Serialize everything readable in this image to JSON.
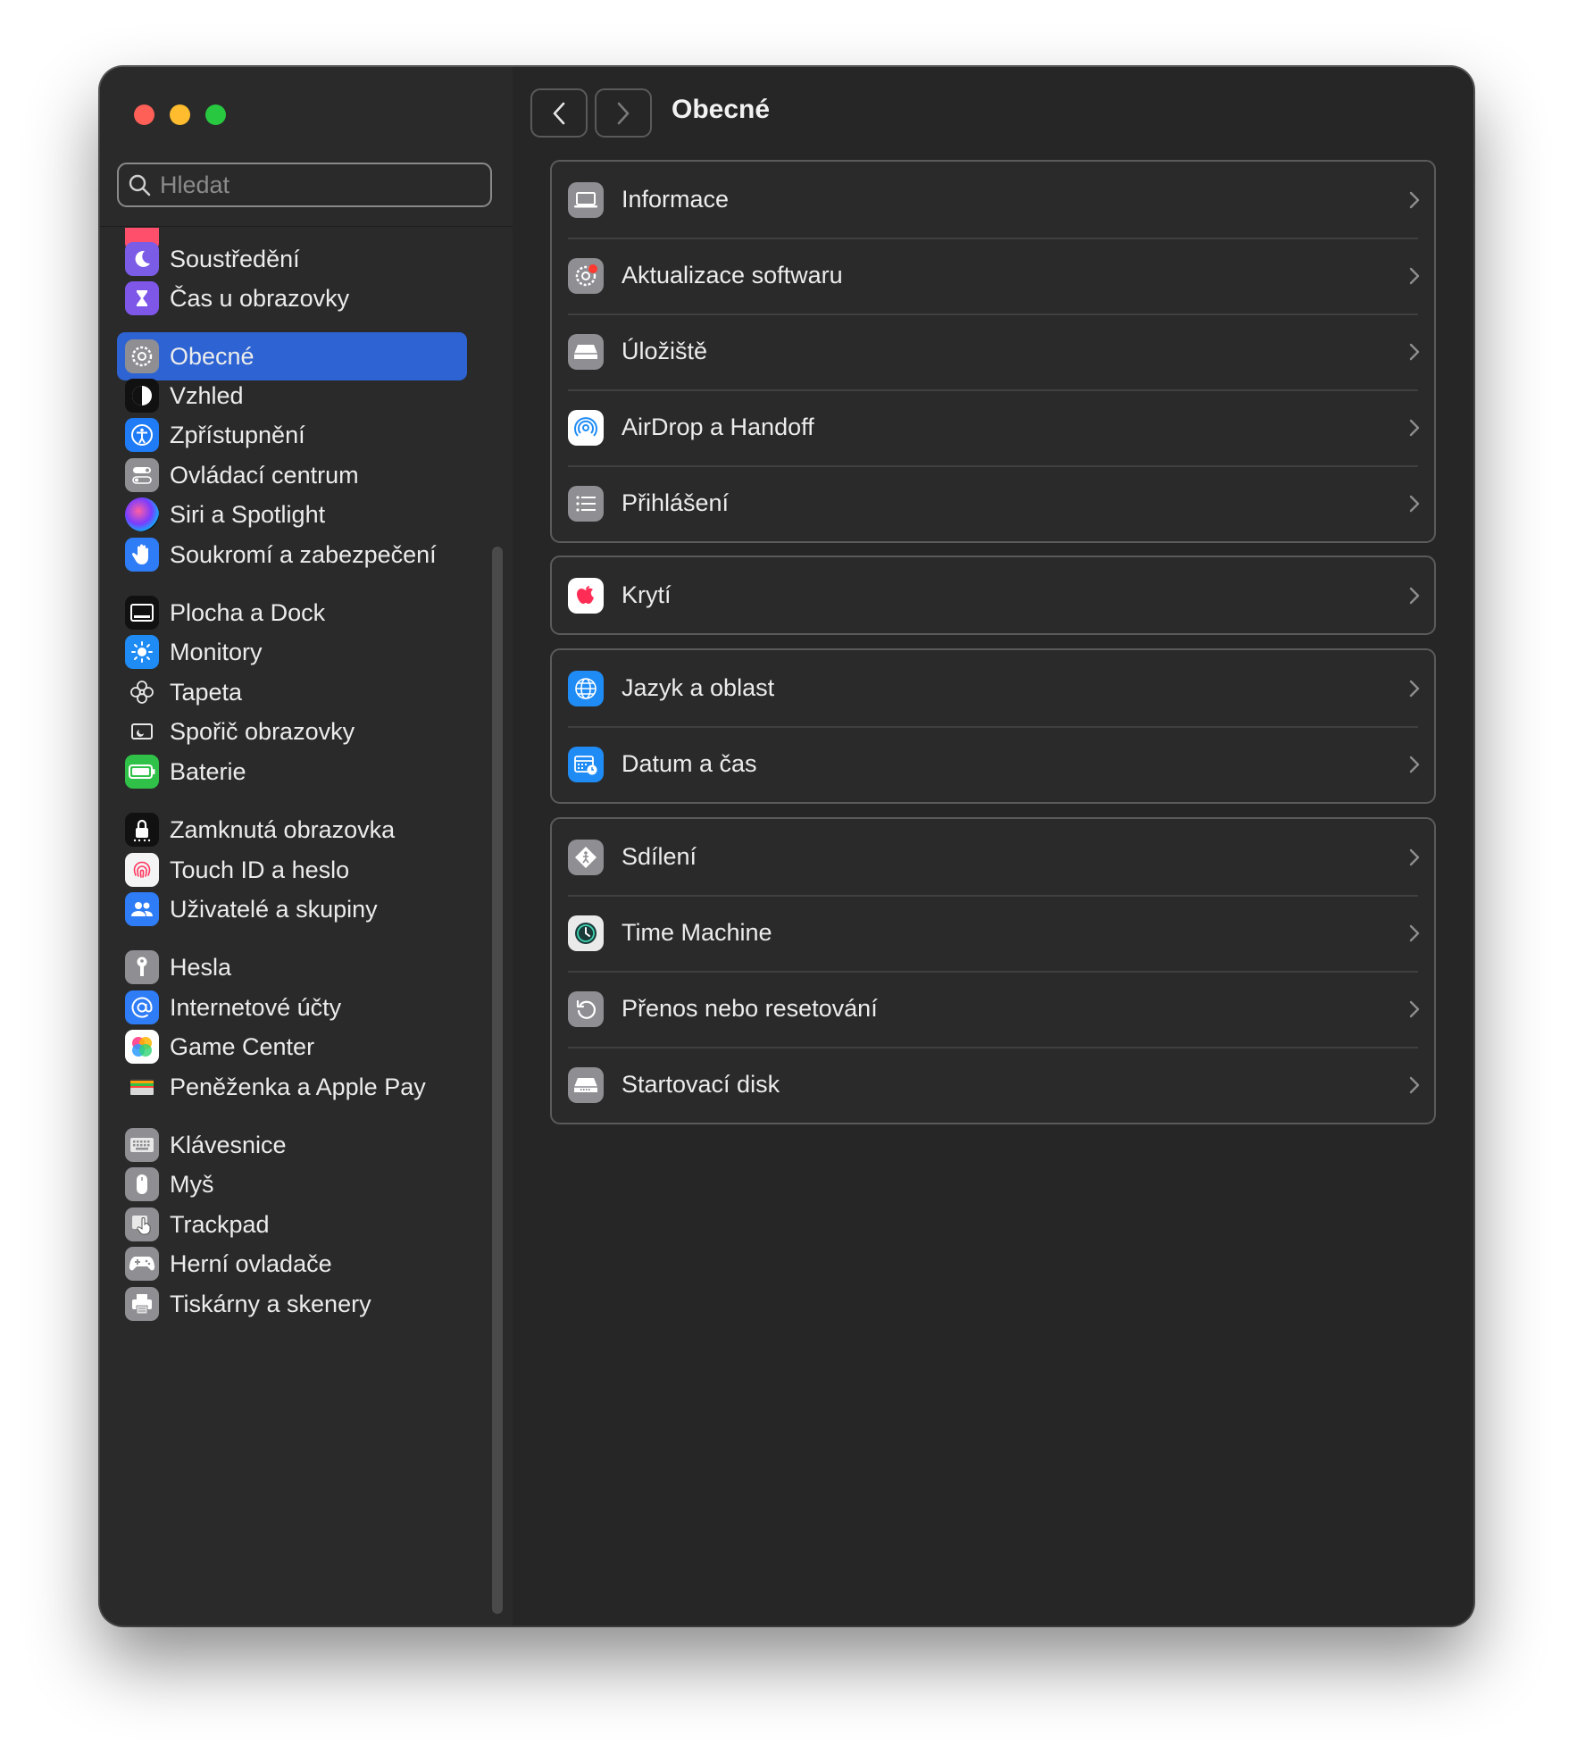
{
  "search": {
    "placeholder": "Hledat"
  },
  "sidebar": {
    "items": [
      {
        "label": "Soustředění",
        "icon": "moon-icon"
      },
      {
        "label": "Čas u obrazovky",
        "icon": "hourglass-icon"
      },
      {
        "label": "Obecné",
        "icon": "gear-icon",
        "active": true
      },
      {
        "label": "Vzhled",
        "icon": "appearance-icon"
      },
      {
        "label": "Zpřístupnění",
        "icon": "accessibility-icon"
      },
      {
        "label": "Ovládací centrum",
        "icon": "control-center-icon"
      },
      {
        "label": "Siri a Spotlight",
        "icon": "siri-icon"
      },
      {
        "label": "Soukromí a zabezpečení",
        "icon": "hand-icon"
      },
      {
        "label": "Plocha a Dock",
        "icon": "dock-icon"
      },
      {
        "label": "Monitory",
        "icon": "sun-icon"
      },
      {
        "label": "Tapeta",
        "icon": "flower-icon"
      },
      {
        "label": "Spořič obrazovky",
        "icon": "screensaver-icon"
      },
      {
        "label": "Baterie",
        "icon": "battery-icon"
      },
      {
        "label": "Zamknutá obrazovka",
        "icon": "lock-icon"
      },
      {
        "label": "Touch ID a heslo",
        "icon": "fingerprint-icon"
      },
      {
        "label": "Uživatelé a skupiny",
        "icon": "users-icon"
      },
      {
        "label": "Hesla",
        "icon": "key-icon"
      },
      {
        "label": "Internetové účty",
        "icon": "at-icon"
      },
      {
        "label": "Game Center",
        "icon": "game-center-icon"
      },
      {
        "label": "Peněženka a Apple Pay",
        "icon": "wallet-icon"
      },
      {
        "label": "Klávesnice",
        "icon": "keyboard-icon"
      },
      {
        "label": "Myš",
        "icon": "mouse-icon"
      },
      {
        "label": "Trackpad",
        "icon": "trackpad-icon"
      },
      {
        "label": "Herní ovladače",
        "icon": "gamepad-icon"
      },
      {
        "label": "Tiskárny a skenery",
        "icon": "printer-icon"
      }
    ]
  },
  "main": {
    "title": "Obecné",
    "groups": [
      [
        {
          "label": "Informace",
          "icon": "laptop-icon"
        },
        {
          "label": "Aktualizace softwaru",
          "icon": "software-update-icon"
        },
        {
          "label": "Úložiště",
          "icon": "disk-icon"
        },
        {
          "label": "AirDrop a Handoff",
          "icon": "airdrop-icon"
        },
        {
          "label": "Přihlášení",
          "icon": "list-icon"
        }
      ],
      [
        {
          "label": "Krytí",
          "icon": "apple-icon"
        }
      ],
      [
        {
          "label": "Jazyk a oblast",
          "icon": "globe-icon"
        },
        {
          "label": "Datum a čas",
          "icon": "calendar-clock-icon"
        }
      ],
      [
        {
          "label": "Sdílení",
          "icon": "sharing-icon"
        },
        {
          "label": "Time Machine",
          "icon": "time-machine-icon"
        },
        {
          "label": "Přenos nebo resetování",
          "icon": "reset-icon"
        },
        {
          "label": "Startovací disk",
          "icon": "startup-disk-icon"
        }
      ]
    ]
  },
  "colors": {
    "accent": "#2d63d3",
    "window": "#262626",
    "sidebar": "#2a2a2a"
  }
}
